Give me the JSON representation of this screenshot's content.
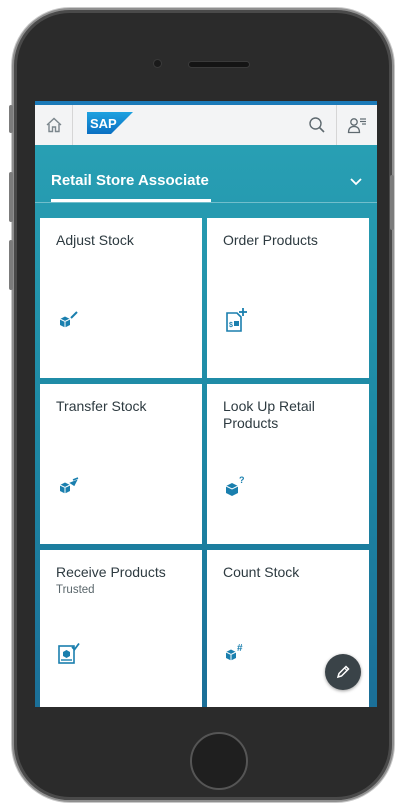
{
  "header": {
    "logo_text": "SAP",
    "home_icon": "home-icon",
    "search_icon": "search-icon",
    "user_icon": "user-menu-icon"
  },
  "group": {
    "title": "Retail Store Associate",
    "chevron_icon": "chevron-down-icon"
  },
  "tiles": [
    {
      "title": "Adjust Stock",
      "subtitle": "",
      "icon": "adjust-stock-icon"
    },
    {
      "title": "Order Products",
      "subtitle": "",
      "icon": "order-products-icon"
    },
    {
      "title": "Transfer Stock",
      "subtitle": "",
      "icon": "transfer-stock-icon"
    },
    {
      "title": "Look Up Retail Products",
      "subtitle": "",
      "icon": "lookup-products-icon"
    },
    {
      "title": "Receive Products",
      "subtitle": "Trusted",
      "icon": "receive-products-icon"
    },
    {
      "title": "Count Stock",
      "subtitle": "",
      "icon": "count-stock-icon"
    }
  ],
  "fab": {
    "icon": "edit-icon"
  },
  "colors": {
    "accent": "#1a7fae",
    "shell_bar_border": "#1b7ab8",
    "header_bg": "#f3f4f5",
    "tile_bg": "#ffffff",
    "fab_bg": "#3a4348"
  }
}
